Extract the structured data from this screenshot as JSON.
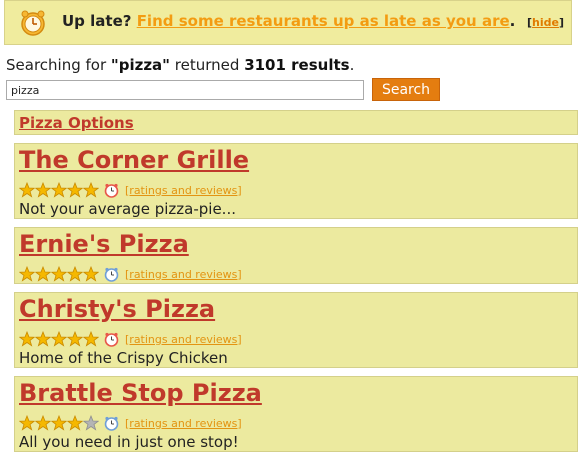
{
  "banner": {
    "prefix": "Up late?",
    "link": "Find some restaurants up as late as you are",
    "suffix": ".",
    "hide_open": "[",
    "hide_label": "hide",
    "hide_close": "]"
  },
  "search": {
    "summary_prefix": "Searching for",
    "query_display": "\"pizza\"",
    "summary_mid": "returned",
    "count": "3101 results",
    "summary_end": ".",
    "input_value": "pizza",
    "button_label": "Search"
  },
  "options_link": "Pizza Options",
  "results": [
    {
      "name": "The Corner Grille",
      "rating": 5,
      "open_late": "red",
      "reviews": "[ratings and reviews]",
      "tagline": "Not your average pizza-pie..."
    },
    {
      "name": "Ernie's Pizza",
      "rating": 5,
      "open_late": "blue",
      "reviews": "[ratings and reviews]",
      "tagline": ""
    },
    {
      "name": "Christy's Pizza",
      "rating": 5,
      "open_late": "red",
      "reviews": "[ratings and reviews]",
      "tagline": "Home of the Crispy Chicken"
    },
    {
      "name": "Brattle Stop Pizza",
      "rating": 4,
      "open_late": "blue",
      "reviews": "[ratings and reviews]",
      "tagline": "All you need in just one stop!"
    }
  ],
  "colors": {
    "panel": "#ecea9f",
    "title_red": "#c0392b",
    "link_orange": "#e39412",
    "button_orange": "#e47d10",
    "star_gold": "#f5b800",
    "star_gray": "#b5b5b5"
  },
  "icons": {
    "banner": "alarm-clock-icon",
    "open_late_red": "red-clock-icon",
    "open_late_blue": "blue-clock-icon",
    "star": "star-icon"
  }
}
